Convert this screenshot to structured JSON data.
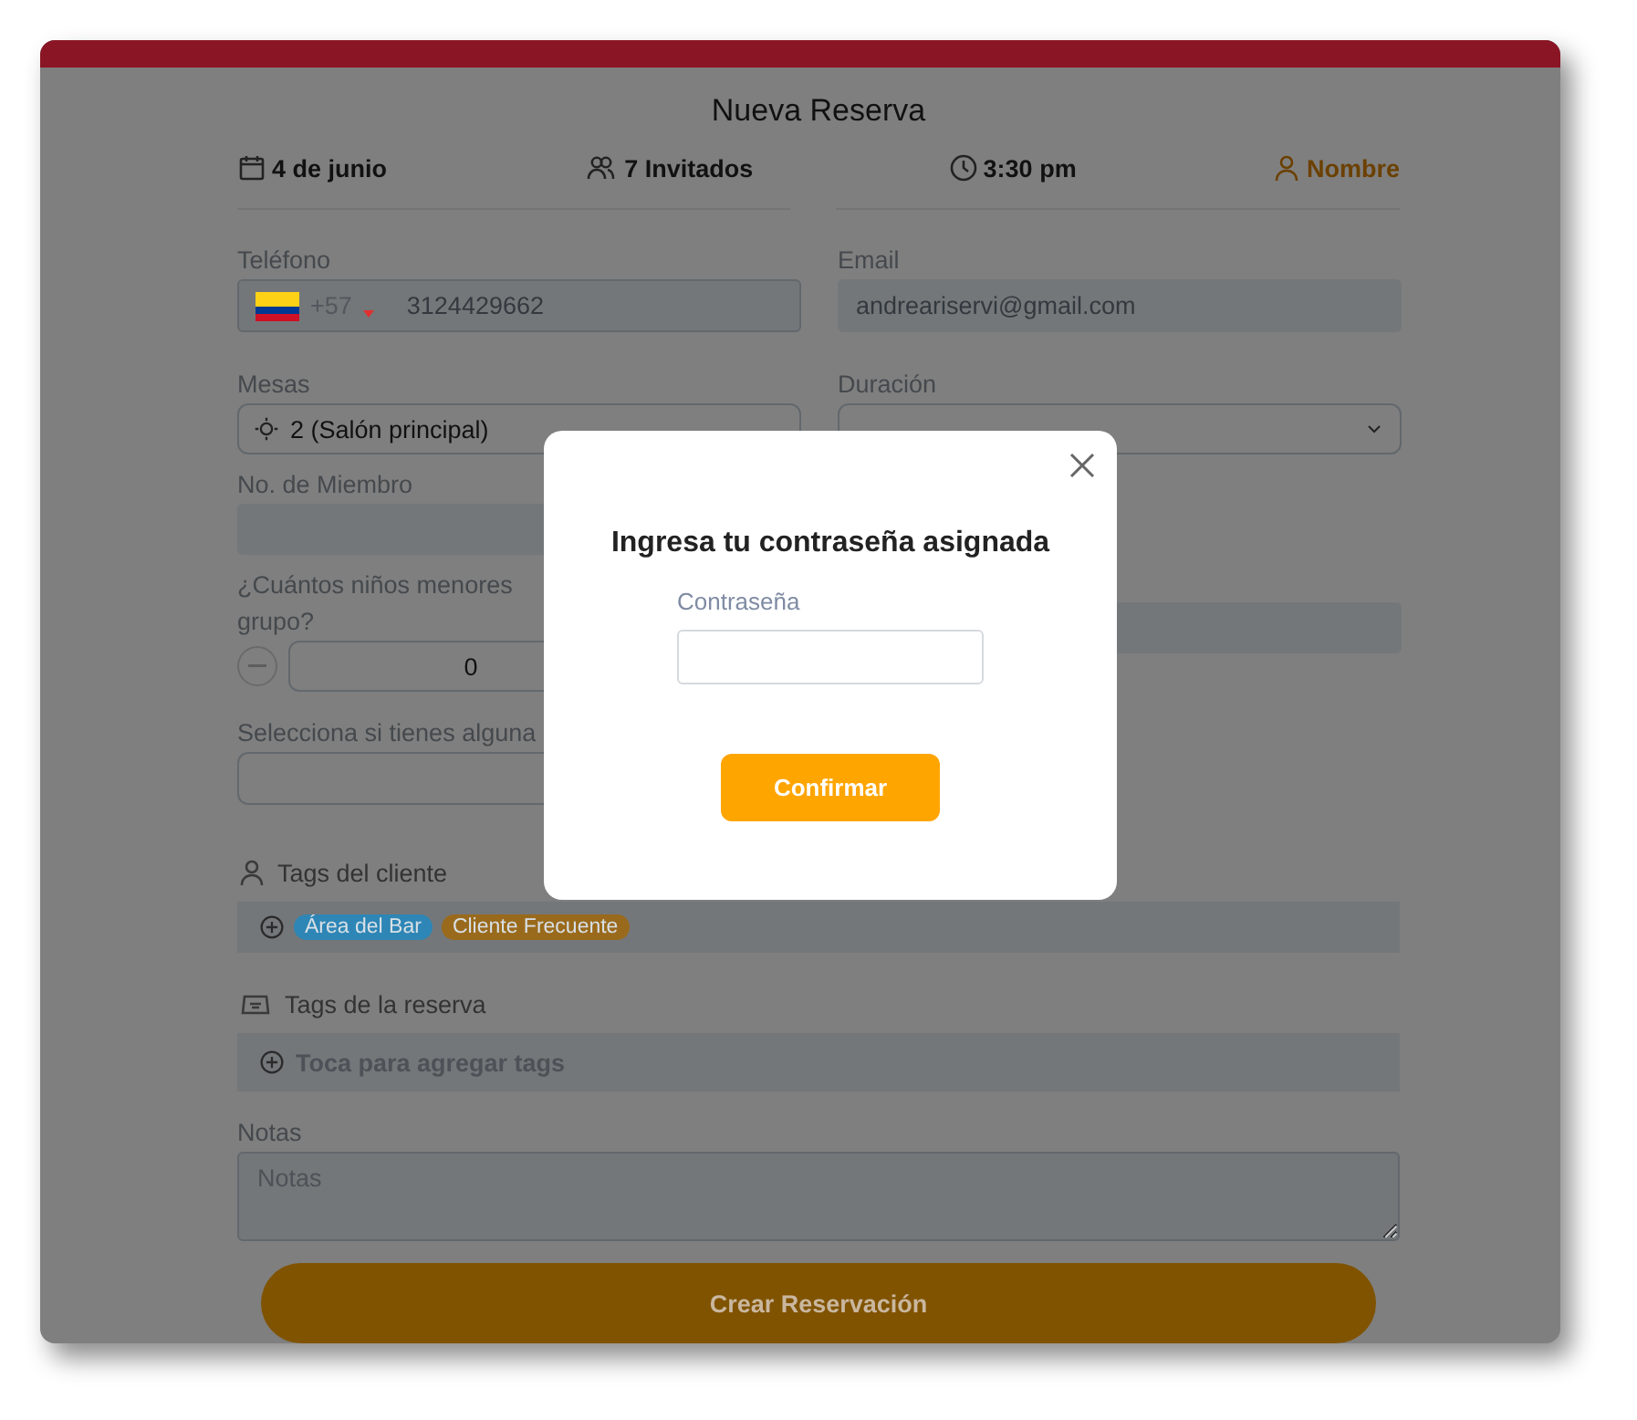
{
  "header": {
    "title": "Nueva Reserva",
    "date": "4 de junio",
    "guests": "7 Invitados",
    "time": "3:30 pm",
    "name": "Nombre"
  },
  "phone": {
    "label": "Teléfono",
    "code": "+57",
    "value": "3124429662"
  },
  "email": {
    "label": "Email",
    "value": "andreariservi@gmail.com"
  },
  "tables": {
    "label": "Mesas",
    "value": "2 (Salón principal)"
  },
  "duration": {
    "label": "Duración"
  },
  "member": {
    "label": "No. de Miembro"
  },
  "children": {
    "label_lines": [
      "¿Cuántos niños menores",
      "grupo?"
    ],
    "value": "0"
  },
  "special": {
    "label": "Selecciona si tienes alguna"
  },
  "client_tags": {
    "label": "Tags del cliente",
    "tags": [
      {
        "label": "Área del Bar",
        "color": "#2e86b6"
      },
      {
        "label": "Cliente Frecuente",
        "color": "#9a6a1c"
      }
    ]
  },
  "reservation_tags": {
    "label": "Tags de la reserva",
    "prompt": "Toca para agregar tags"
  },
  "notes": {
    "label": "Notas",
    "placeholder": "Notas"
  },
  "submit": "Crear Reservación",
  "modal": {
    "title": "Ingresa tu contraseña asignada",
    "field_label": "Contraseña",
    "confirm": "Confirmar"
  }
}
